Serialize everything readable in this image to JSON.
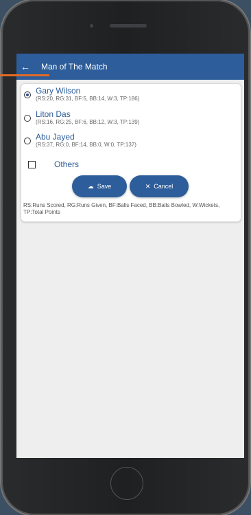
{
  "appbar": {
    "back_icon": "arrow-left-icon",
    "title": "Man of The Match"
  },
  "players": [
    {
      "name": "Gary Wilson",
      "stats": "(RS:20, RG:31, BF:5, BB:14, W:3, TP:186)",
      "selected": true
    },
    {
      "name": "Liton Das",
      "stats": "(RS:16, RG:25, BF:6, BB:12, W:3, TP:139)",
      "selected": false
    },
    {
      "name": "Abu Jayed",
      "stats": "(RS:37, RG:0, BF:14, BB:0, W:0, TP:137)",
      "selected": false
    }
  ],
  "others": {
    "label": "Others",
    "checked": false
  },
  "buttons": {
    "save_label": "Save",
    "save_icon": "cloud-upload-icon",
    "cancel_label": "Cancel",
    "cancel_icon": "close-icon"
  },
  "legend": "RS:Runs Scored, RG:Runs Given, BF:Balls Faced, BB:Balls Bowled, W:Wickets, TP:Total Points",
  "colors": {
    "primary": "#2d5d9a",
    "accent": "#e36b25",
    "screen_bg": "#eeeeee"
  }
}
